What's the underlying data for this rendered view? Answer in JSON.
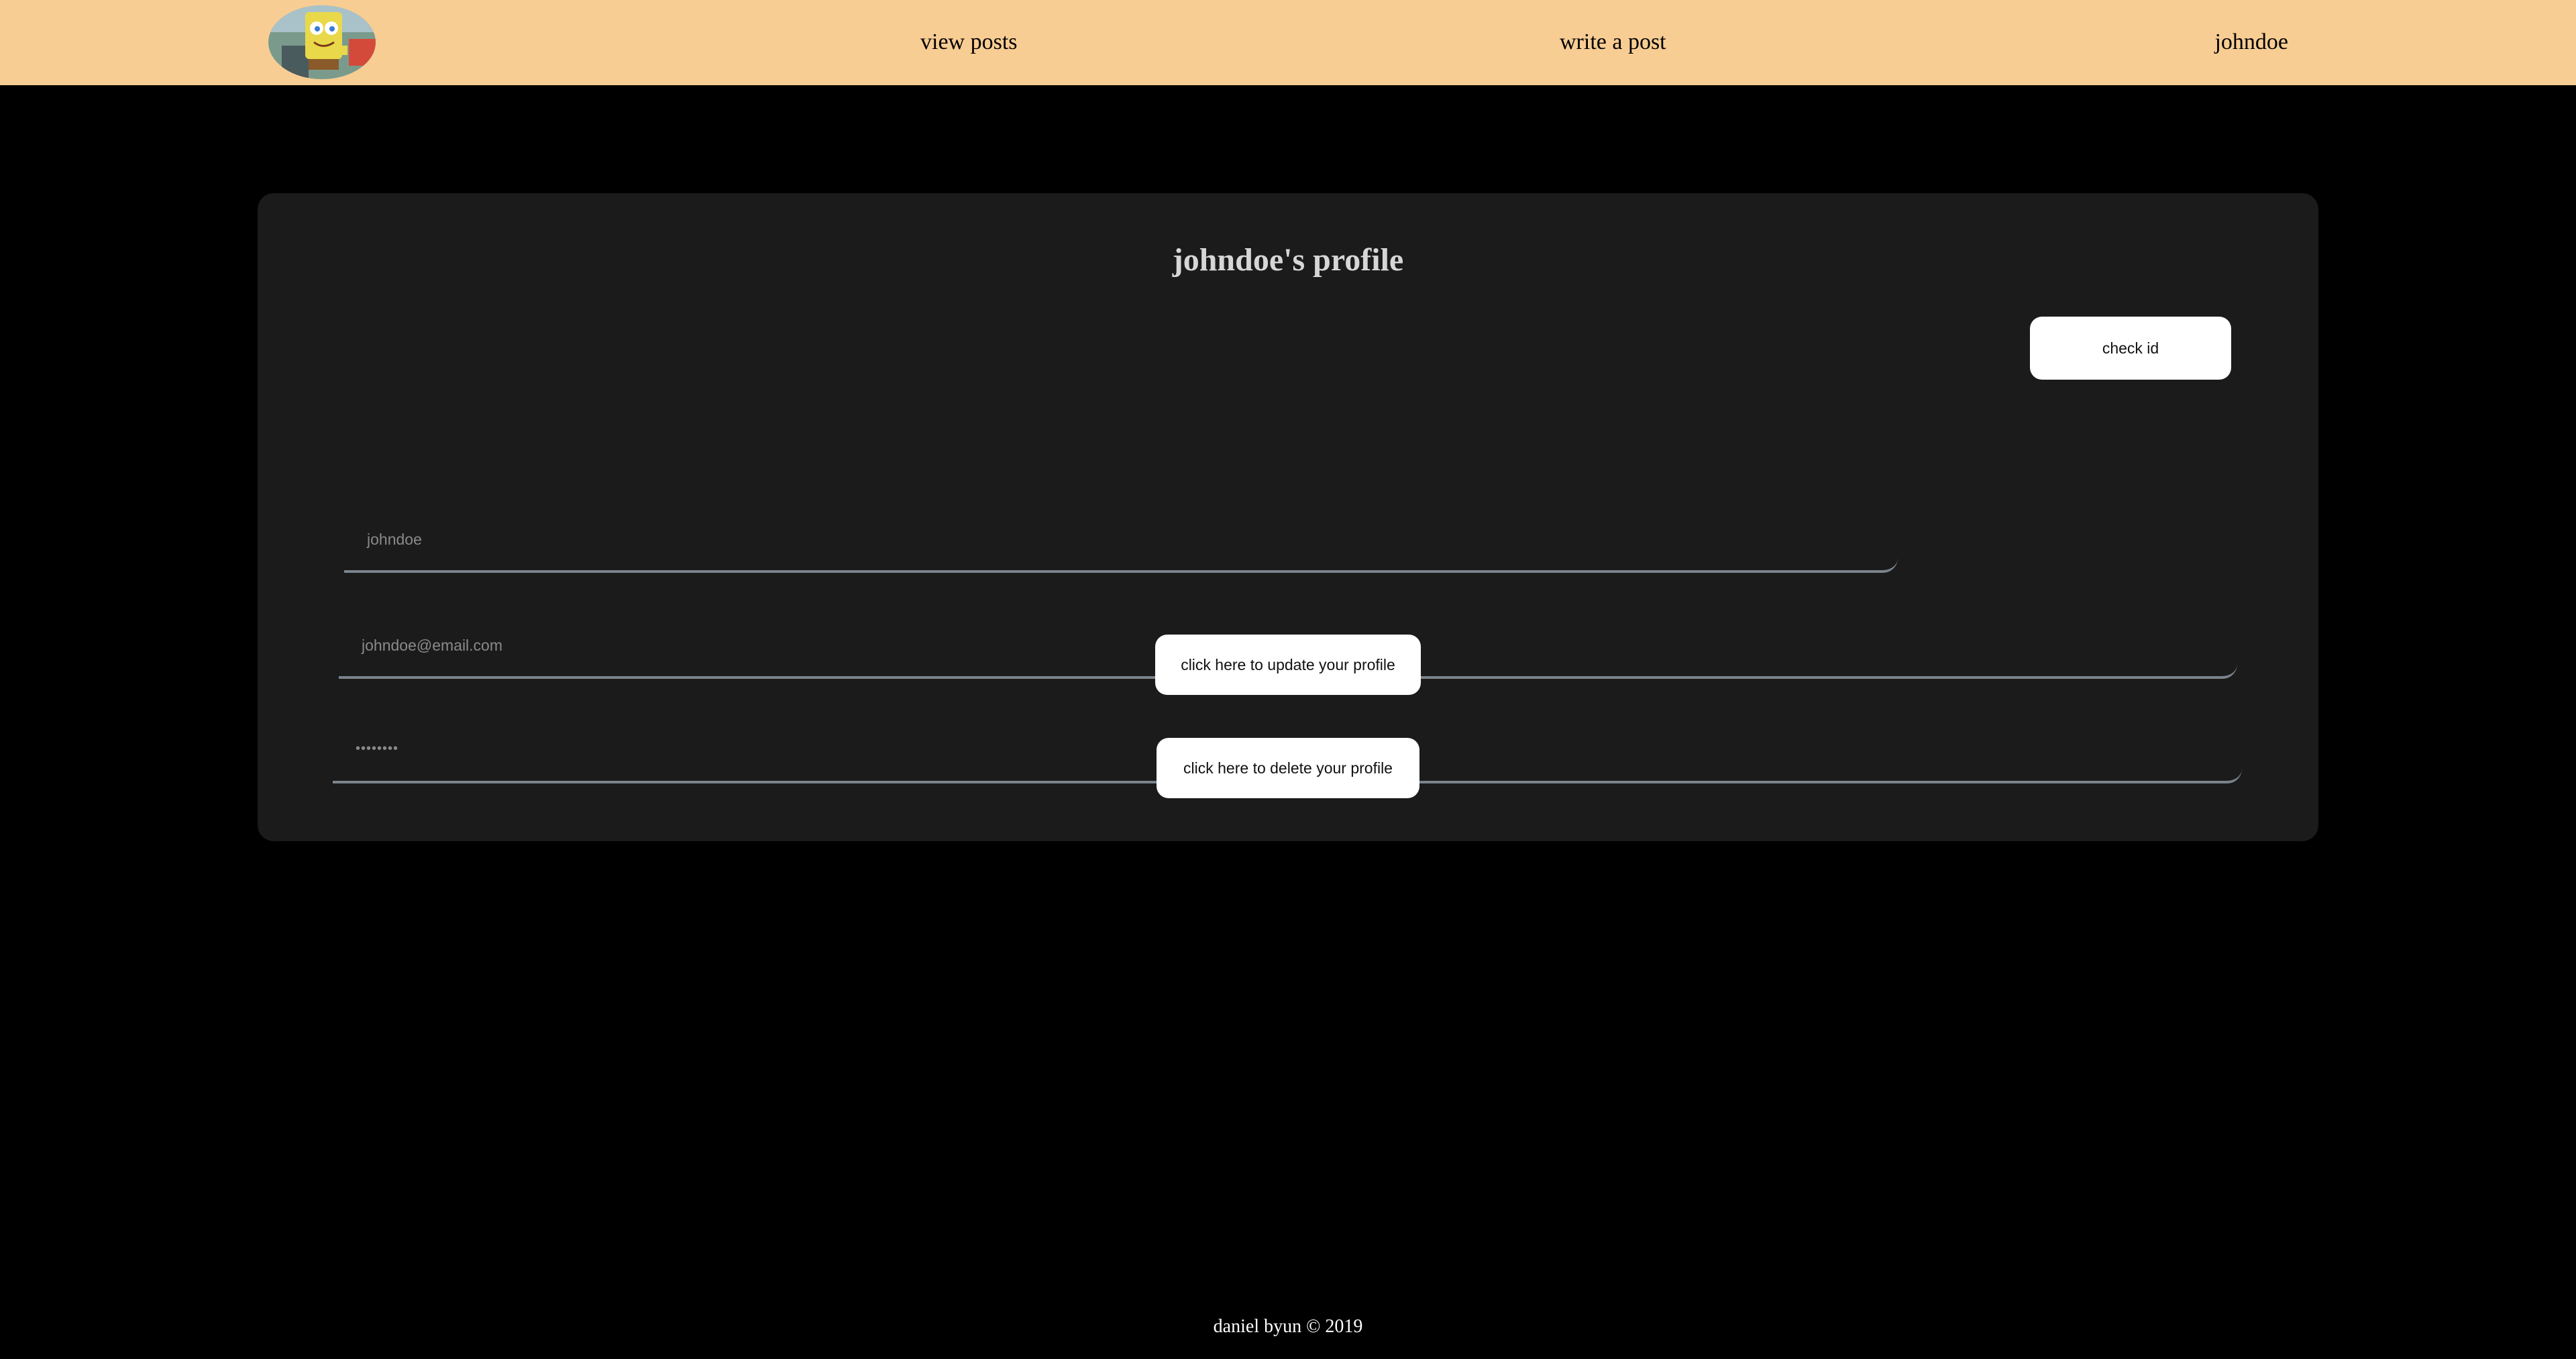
{
  "nav": {
    "links": [
      {
        "label": "view posts"
      },
      {
        "label": "write a post"
      },
      {
        "label": "johndoe"
      }
    ]
  },
  "profile": {
    "title": "johndoe's profile",
    "username_placeholder": "johndoe",
    "email_placeholder": "johndoe@email.com",
    "password_placeholder": "••••••••",
    "confirm_password_placeholder": "••••••••",
    "check_id_label": "check id",
    "update_label": "click here to update your profile",
    "delete_label": "click here to delete your profile"
  },
  "footer": {
    "text": "daniel byun © 2019"
  },
  "colors": {
    "navbar": "#f8cd93",
    "background": "#000000",
    "card": "#1b1b1b",
    "field_underline": "#7b848c",
    "button": "#ffffff"
  }
}
